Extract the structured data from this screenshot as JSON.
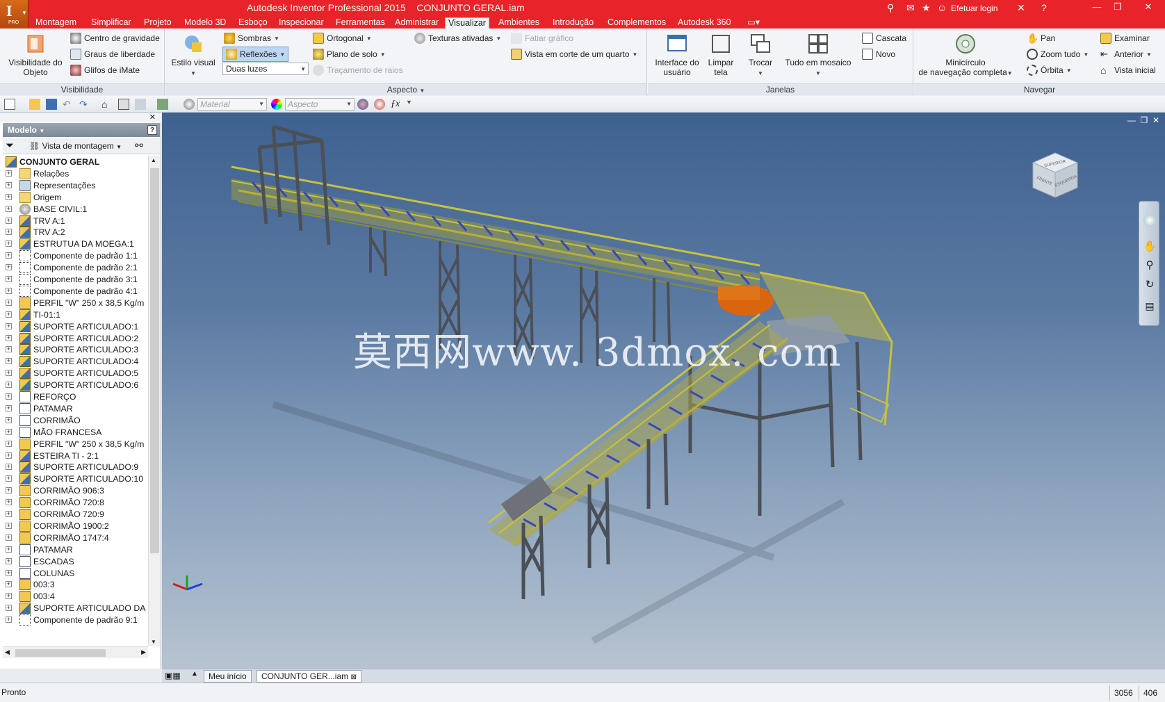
{
  "app": {
    "logo_letter": "I",
    "logo_sub": "PRO",
    "title": "Autodesk Inventor Professional 2015    CONJUNTO GERAL.iam",
    "login": "Efetuar login"
  },
  "menu_tabs": [
    "Montagem",
    "Simplificar",
    "Projeto",
    "Modelo 3D",
    "Esboço",
    "Inspecionar",
    "Ferramentas",
    "Administrar",
    "Visualizar",
    "Ambientes",
    "Introdução",
    "Complementos",
    "Autodesk 360"
  ],
  "active_tab": "Visualizar",
  "ribbon": {
    "visibilidade": {
      "title": "Visibilidade",
      "object_visibility": "Visibilidade do\nObjeto",
      "centro_gravidade": "Centro de gravidade",
      "graus_liberdade": "Graus de liberdade",
      "glifos": "Glifos de iMate"
    },
    "aspecto": {
      "title": "Aspecto",
      "estilo_visual": "Estilo visual",
      "sombras": "Sombras",
      "reflexoes": "Reflexões",
      "luzes": "Duas luzes",
      "ortogonal": "Ortogonal",
      "plano_solo": "Plano de solo",
      "tracamento": "Traçamento de raios",
      "texturas": "Texturas ativadas",
      "fatiar": "Fatiar gráfico",
      "vista_corte": "Vista em corte de um quarto"
    },
    "janelas": {
      "title": "Janelas",
      "interface": "Interface do\nusuário",
      "limpar": "Limpar\ntela",
      "trocar": "Trocar",
      "mosaico": "Tudo em mosaico",
      "cascata": "Cascata",
      "novo": "Novo"
    },
    "navegar": {
      "title": "Navegar",
      "minicirculo": "Minicírculo\nde navegação completa",
      "pan": "Pan",
      "zoom": "Zoom tudo",
      "orbita": "Órbita",
      "examinar": "Examinar",
      "anterior": "Anterior",
      "vista_inicial": "Vista inicial"
    }
  },
  "qat": {
    "material_placeholder": "Material",
    "aspecto_placeholder": "Aspecto"
  },
  "browser": {
    "header": "Modelo",
    "view_mode": "Vista de montagem",
    "root": "CONJUNTO GERAL",
    "items": [
      {
        "label": "Relações",
        "icon": "folder"
      },
      {
        "label": "Representações",
        "icon": "rep"
      },
      {
        "label": "Origem",
        "icon": "folder"
      },
      {
        "label": "BASE CIVIL:1",
        "icon": "civil"
      },
      {
        "label": "TRV A:1",
        "icon": "asm"
      },
      {
        "label": "TRV A:2",
        "icon": "asm"
      },
      {
        "label": "ESTRUTUA DA MOEGA:1",
        "icon": "asm"
      },
      {
        "label": "Componente de padrão 1:1",
        "icon": "pattern"
      },
      {
        "label": "Componente de padrão 2:1",
        "icon": "pattern"
      },
      {
        "label": "Componente de padrão 3:1",
        "icon": "pattern"
      },
      {
        "label": "Componente de padrão 4:1",
        "icon": "pattern"
      },
      {
        "label": "PERFIL \"W\" 250 x 38,5 Kg/m",
        "icon": "part"
      },
      {
        "label": "TI-01:1",
        "icon": "asm"
      },
      {
        "label": "SUPORTE ARTICULADO:1",
        "icon": "asm"
      },
      {
        "label": "SUPORTE ARTICULADO:2",
        "icon": "asm"
      },
      {
        "label": "SUPORTE ARTICULADO:3",
        "icon": "asm"
      },
      {
        "label": "SUPORTE ARTICULADO:4",
        "icon": "asm"
      },
      {
        "label": "SUPORTE ARTICULADO:5",
        "icon": "asm"
      },
      {
        "label": "SUPORTE ARTICULADO:6",
        "icon": "asm"
      },
      {
        "label": "REFORÇO",
        "icon": "frame"
      },
      {
        "label": "PATAMAR",
        "icon": "frame"
      },
      {
        "label": "CORRIMÃO",
        "icon": "frame"
      },
      {
        "label": "MÃO FRANCESA",
        "icon": "frame"
      },
      {
        "label": "PERFIL \"W\" 250 x 38,5 Kg/m",
        "icon": "part"
      },
      {
        "label": "ESTEIRA TI - 2:1",
        "icon": "asm"
      },
      {
        "label": "SUPORTE ARTICULADO:9",
        "icon": "asm"
      },
      {
        "label": "SUPORTE ARTICULADO:10",
        "icon": "asm"
      },
      {
        "label": "CORRIMÃO 906:3",
        "icon": "part"
      },
      {
        "label": "CORRIMÃO 720:8",
        "icon": "part"
      },
      {
        "label": "CORRIMÃO 720:9",
        "icon": "part"
      },
      {
        "label": "CORRIMÃO 1900:2",
        "icon": "part"
      },
      {
        "label": "CORRIMÃO 1747:4",
        "icon": "part"
      },
      {
        "label": "PATAMAR",
        "icon": "frame"
      },
      {
        "label": "ESCADAS",
        "icon": "frame"
      },
      {
        "label": "COLUNAS",
        "icon": "frame"
      },
      {
        "label": "003:3",
        "icon": "part"
      },
      {
        "label": "003:4",
        "icon": "part"
      },
      {
        "label": "SUPORTE ARTICULADO DA TC",
        "icon": "asm"
      },
      {
        "label": "Componente de padrão 9:1",
        "icon": "pattern"
      }
    ]
  },
  "viewport": {
    "watermark": "莫西网www. 3dmox. com",
    "viewcube_faces": [
      "SUPERIOR",
      "FRENTE",
      "ESQUERDA"
    ]
  },
  "doc_tabs": [
    "Meu início",
    "CONJUNTO GER...iam"
  ],
  "status": {
    "text": "Pronto",
    "coord1": "3056",
    "coord2": "406"
  },
  "colors": {
    "titlebar": "#e8242a",
    "structure_yellow": "#c8c23a",
    "steel_gray": "#4b4f57",
    "hopper_orange": "#d9650f"
  }
}
